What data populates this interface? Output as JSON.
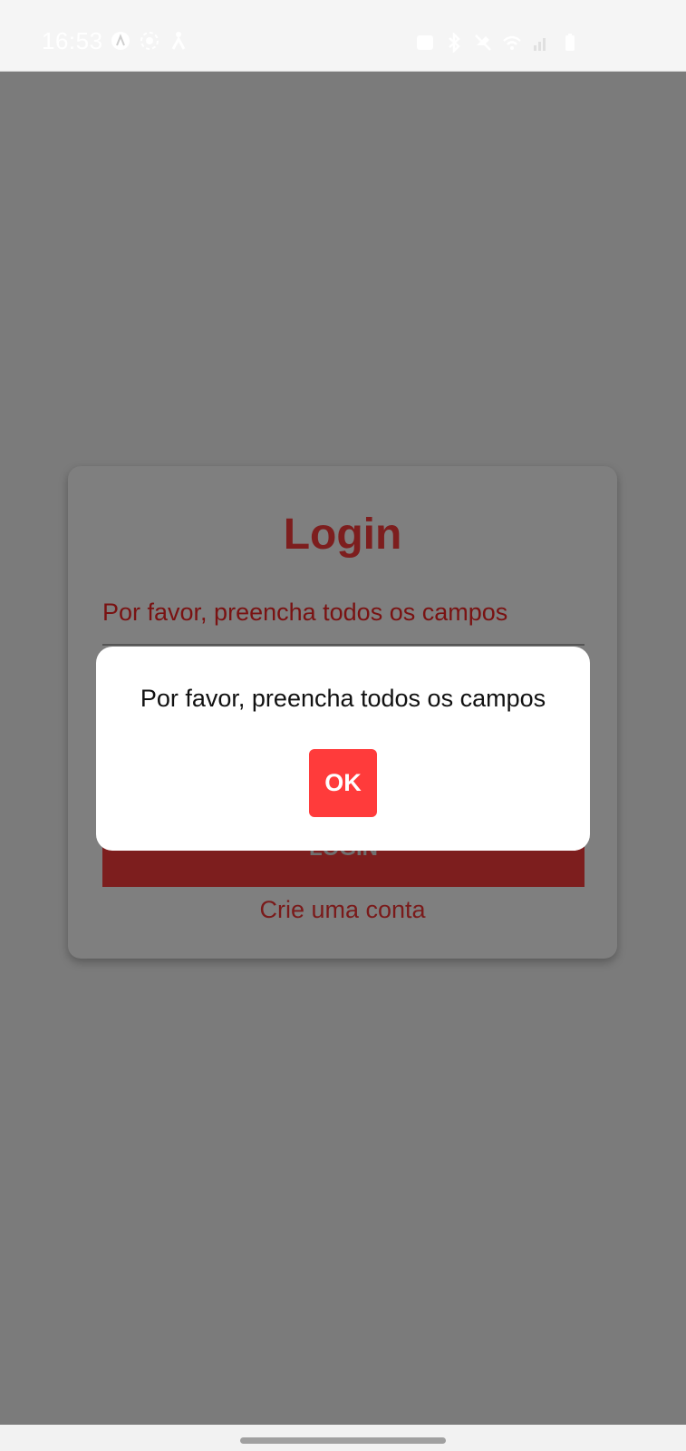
{
  "status_bar": {
    "time": "16:53",
    "left_icons": [
      "app-notification-icon",
      "screen-record-icon",
      "accessibility-icon"
    ],
    "right_icons": [
      "alarm-icon",
      "bluetooth-icon",
      "mute-icon",
      "wifi-icon",
      "signal-icon",
      "battery-icon"
    ]
  },
  "login": {
    "title": "Login",
    "error_message": "Por favor, preencha todos os campos",
    "login_button": "LOGIN",
    "create_account_link": "Crie uma conta"
  },
  "alert": {
    "message": "Por favor, preencha todos os campos",
    "ok_label": "OK"
  },
  "colors": {
    "accent": "#7d1e1e",
    "ok_button": "#ff3b3b",
    "overlay": "#7b7b7b"
  }
}
